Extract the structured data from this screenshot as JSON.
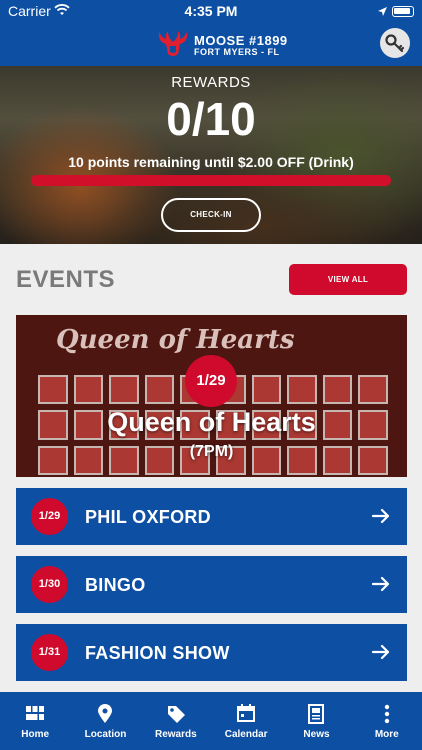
{
  "status_bar": {
    "carrier": "Carrier",
    "time": "4:35 PM"
  },
  "header": {
    "logo_name": "MOOSE #1899",
    "logo_sub": "FORT MYERS - FL"
  },
  "rewards": {
    "label": "REWARDS",
    "count": "0/10",
    "message": "10 points remaining until $2.00 OFF (Drink)",
    "progress_fraction": 0.0,
    "checkin_label": "CHECK-IN"
  },
  "events": {
    "title": "EVENTS",
    "view_all_label": "VIEW ALL",
    "featured": {
      "date": "1/29",
      "title": "Queen of Hearts",
      "time": "(7PM)",
      "art_text": "Queen of Hearts"
    },
    "list": [
      {
        "date": "1/29",
        "name": "PHIL OXFORD"
      },
      {
        "date": "1/30",
        "name": "BINGO"
      },
      {
        "date": "1/31",
        "name": "FASHION SHOW"
      }
    ]
  },
  "tabs": [
    {
      "label": "Home",
      "icon": "home-grid-icon"
    },
    {
      "label": "Location",
      "icon": "location-pin-icon"
    },
    {
      "label": "Rewards",
      "icon": "tag-icon"
    },
    {
      "label": "Calendar",
      "icon": "calendar-icon"
    },
    {
      "label": "News",
      "icon": "newspaper-icon"
    },
    {
      "label": "More",
      "icon": "more-vertical-icon"
    }
  ],
  "colors": {
    "brand_blue": "#0d4fa3",
    "accent_red": "#cf0a2c",
    "background": "#eeeeee"
  }
}
